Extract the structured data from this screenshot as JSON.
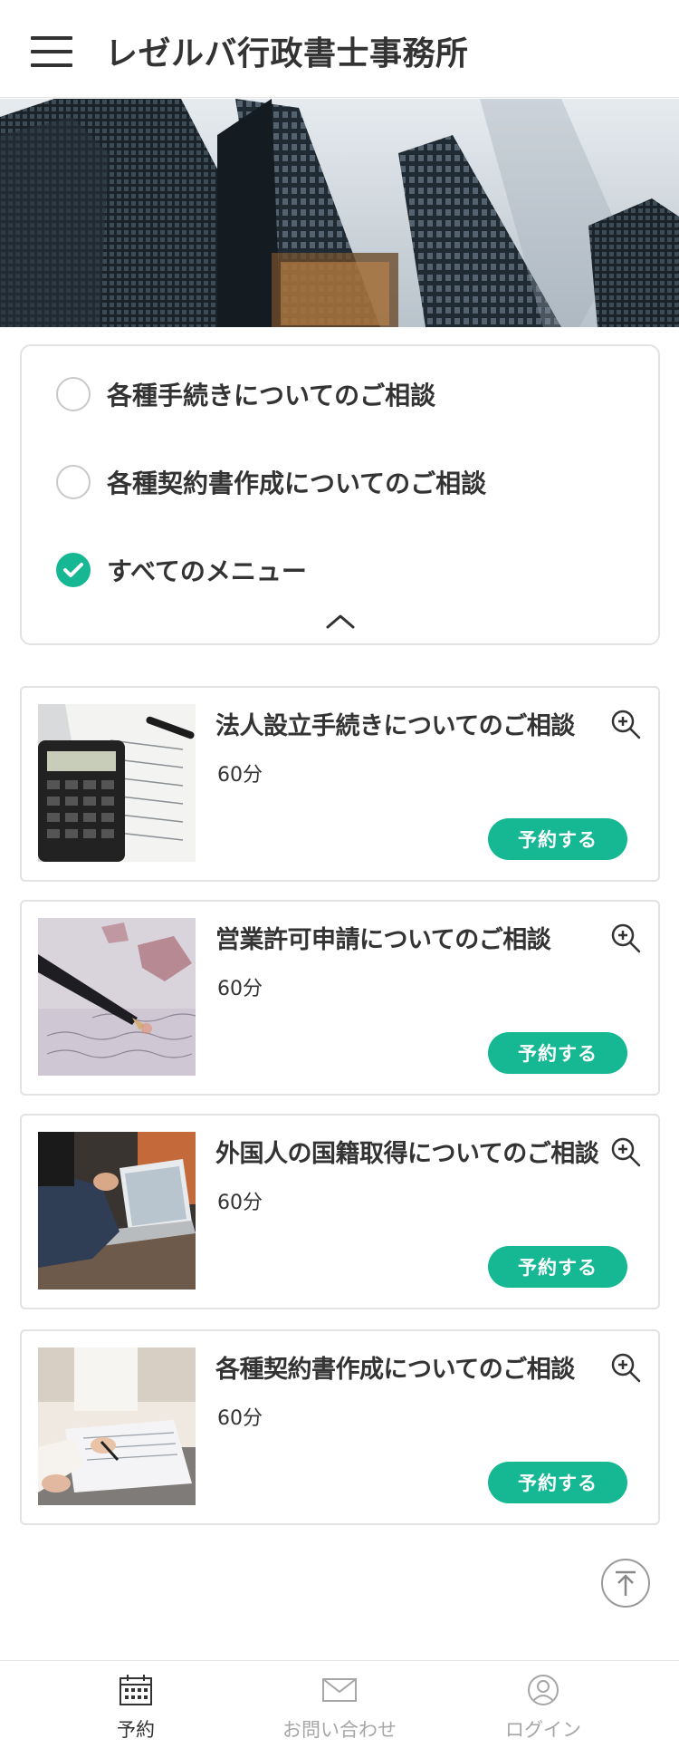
{
  "header": {
    "site_title": "レゼルバ行政書士事務所"
  },
  "filter": {
    "options": [
      {
        "label": "各種手続きについてのご相談",
        "selected": false
      },
      {
        "label": "各種契約書作成についてのご相談",
        "selected": false
      },
      {
        "label": "すべてのメニュー",
        "selected": true
      }
    ]
  },
  "menu_items": [
    {
      "title": "法人設立手続きについてのご相談",
      "duration": "60分",
      "button": "予約する",
      "thumb": "calculator-documents"
    },
    {
      "title": "営業許可申請についてのご相談",
      "duration": "60分",
      "button": "予約する",
      "thumb": "fountain-pen-letter"
    },
    {
      "title": "外国人の国籍取得についてのご相談",
      "duration": "60分",
      "button": "予約する",
      "thumb": "laptop-meeting"
    },
    {
      "title": "各種契約書作成についてのご相談",
      "duration": "60分",
      "button": "予約する",
      "thumb": "signing-contract"
    }
  ],
  "bottom_nav": [
    {
      "label": "予約",
      "icon": "calendar-icon",
      "active": true
    },
    {
      "label": "お問い合わせ",
      "icon": "mail-icon",
      "active": false
    },
    {
      "label": "ログイン",
      "icon": "user-icon",
      "active": false
    }
  ],
  "colors": {
    "accent": "#16b894",
    "text": "#333333",
    "border": "#e2e2e2",
    "inactive_nav": "#a6a6a6"
  }
}
